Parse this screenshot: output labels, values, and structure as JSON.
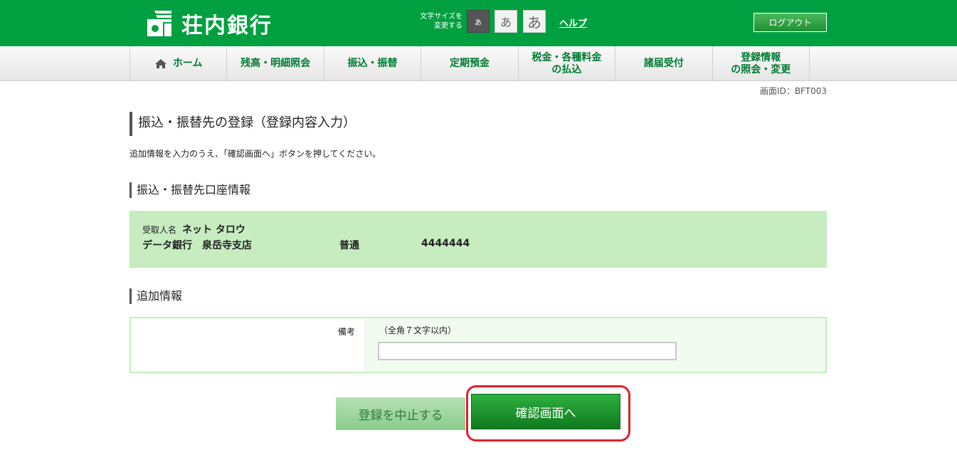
{
  "header": {
    "bank_name": "荘内銀行",
    "font_size_label_1": "文字サイズを",
    "font_size_label_2": "変更する",
    "font_small": "あ",
    "font_medium": "あ",
    "font_large": "あ",
    "help": "ヘルプ",
    "logout": "ログアウト",
    "brand_color": "#00a040"
  },
  "nav": {
    "items": [
      {
        "label": "ホーム",
        "icon": "home-icon"
      },
      {
        "label": "残高・明細照会"
      },
      {
        "label": "振込・振替"
      },
      {
        "label": "定期預金"
      },
      {
        "label_line1": "税金・各種料金",
        "label_line2": "の払込"
      },
      {
        "label": "諸届受付"
      },
      {
        "label_line1": "登録情報",
        "label_line2": "の照会・変更"
      }
    ]
  },
  "screen_id": "画面ID：BFT003",
  "page": {
    "title": "振込・振替先の登録（登録内容入力）",
    "instruction": "追加情報を入力のうえ、「確認画面へ」ボタンを押してください。"
  },
  "account_section": {
    "title": "振込・振替先口座情報",
    "recipient_label": "受取人名",
    "recipient_name": "ネット タロウ",
    "bank_branch": "データ銀行　泉岳寺支店",
    "account_type": "普通",
    "account_number": "4444444"
  },
  "additional_section": {
    "title": "追加情報",
    "memo_label": "備考",
    "memo_note": "（全角７文字以内）",
    "memo_value": ""
  },
  "buttons": {
    "cancel": "登録を中止する",
    "confirm": "確認画面へ"
  }
}
